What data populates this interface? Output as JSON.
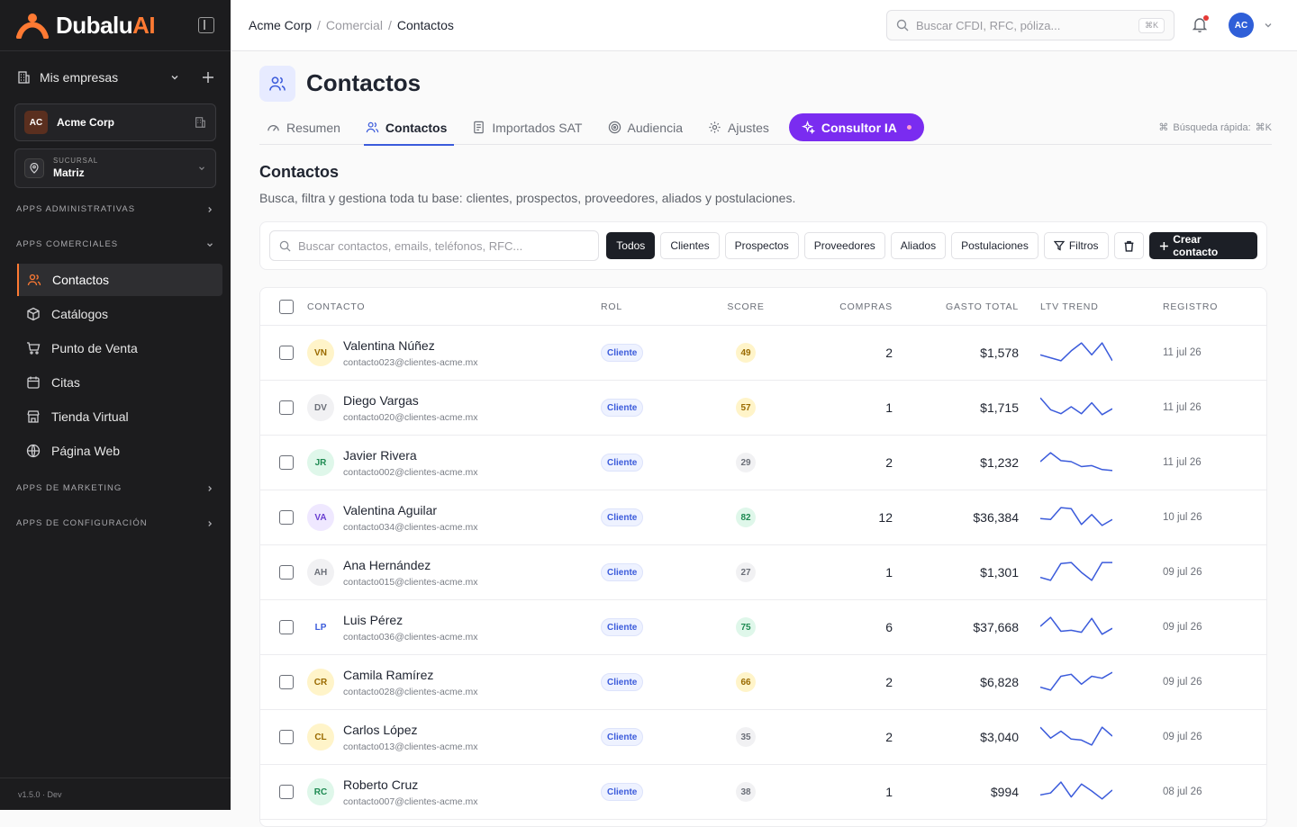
{
  "app": {
    "brand_main": "Dubalu",
    "brand_ai": "AI",
    "version": "v1.5.0 · Dev"
  },
  "sidebar": {
    "mis_empresas": "Mis empresas",
    "company": {
      "initials": "AC",
      "name": "Acme Corp"
    },
    "branch": {
      "label": "SUCURSAL",
      "value": "Matriz"
    },
    "sections": {
      "admin": "APPS ADMINISTRATIVAS",
      "comercial": "APPS COMERCIALES",
      "marketing": "APPS DE MARKETING",
      "config": "APPS DE CONFIGURACIÓN"
    },
    "items": [
      {
        "label": "Contactos",
        "icon": "users-icon"
      },
      {
        "label": "Catálogos",
        "icon": "box-icon"
      },
      {
        "label": "Punto de Venta",
        "icon": "cart-icon"
      },
      {
        "label": "Citas",
        "icon": "calendar-icon"
      },
      {
        "label": "Tienda Virtual",
        "icon": "store-icon"
      },
      {
        "label": "Página Web",
        "icon": "globe-icon"
      }
    ]
  },
  "topbar": {
    "breadcrumb": [
      "Acme Corp",
      "Comercial",
      "Contactos"
    ],
    "search_placeholder": "Buscar CFDI, RFC, póliza...",
    "search_kbd": "⌘K",
    "user_initials": "AC"
  },
  "page": {
    "title": "Contactos",
    "tabs": [
      {
        "label": "Resumen",
        "icon": "gauge-icon"
      },
      {
        "label": "Contactos",
        "icon": "users-icon"
      },
      {
        "label": "Importados SAT",
        "icon": "document-icon"
      },
      {
        "label": "Audiencia",
        "icon": "target-icon"
      },
      {
        "label": "Ajustes",
        "icon": "gear-icon"
      },
      {
        "label": "Consultor IA",
        "icon": "sparkle-icon"
      }
    ],
    "quick_search_label": "Búsqueda rápida:",
    "quick_search_kbd": "⌘K",
    "section_title": "Contactos",
    "section_desc": "Busca, filtra y gestiona toda tu base: clientes, prospectos, proveedores, aliados y postulaciones."
  },
  "filters": {
    "search_placeholder": "Buscar contactos, emails, teléfonos, RFC...",
    "chips": [
      "Todos",
      "Clientes",
      "Prospectos",
      "Proveedores",
      "Aliados",
      "Postulaciones"
    ],
    "filtros": "Filtros",
    "create": "Crear contacto"
  },
  "table": {
    "headers": {
      "contacto": "CONTACTO",
      "rol": "ROL",
      "score": "SCORE",
      "compras": "COMPRAS",
      "gasto": "GASTO TOTAL",
      "ltv": "LTV TREND",
      "registro": "REGISTRO"
    },
    "rows": [
      {
        "initials": "VN",
        "name": "Valentina Núñez",
        "email": "contacto023@clientes-acme.mx",
        "rol": "Cliente",
        "score": "49",
        "compras": "2",
        "gasto": "$1,578",
        "fecha": "11 jul 26",
        "trend": [
          0.35,
          0.2,
          0.05,
          0.55,
          0.95,
          0.35,
          0.95,
          0.05
        ]
      },
      {
        "initials": "DV",
        "name": "Diego Vargas",
        "email": "contacto020@clientes-acme.mx",
        "rol": "Cliente",
        "score": "57",
        "compras": "1",
        "gasto": "$1,715",
        "fecha": "11 jul 26",
        "trend": [
          0.95,
          0.35,
          0.15,
          0.5,
          0.15,
          0.7,
          0.1,
          0.4
        ]
      },
      {
        "initials": "JR",
        "name": "Javier Rivera",
        "email": "contacto002@clientes-acme.mx",
        "rol": "Cliente",
        "score": "29",
        "compras": "2",
        "gasto": "$1,232",
        "fecha": "11 jul 26",
        "trend": [
          0.5,
          0.95,
          0.55,
          0.5,
          0.25,
          0.3,
          0.1,
          0.05
        ]
      },
      {
        "initials": "VA",
        "name": "Valentina Aguilar",
        "email": "contacto034@clientes-acme.mx",
        "rol": "Cliente",
        "score": "82",
        "compras": "12",
        "gasto": "$36,384",
        "fecha": "10 jul 26",
        "trend": [
          0.4,
          0.35,
          0.95,
          0.9,
          0.1,
          0.6,
          0.05,
          0.35
        ]
      },
      {
        "initials": "AH",
        "name": "Ana Hernández",
        "email": "contacto015@clientes-acme.mx",
        "rol": "Cliente",
        "score": "27",
        "compras": "1",
        "gasto": "$1,301",
        "fecha": "09 jul 26",
        "trend": [
          0.2,
          0.05,
          0.9,
          0.95,
          0.45,
          0.05,
          0.95,
          0.95
        ]
      },
      {
        "initials": "LP",
        "name": "Luis Pérez",
        "email": "contacto036@clientes-acme.mx",
        "rol": "Cliente",
        "score": "75",
        "compras": "6",
        "gasto": "$37,668",
        "fecha": "09 jul 26",
        "trend": [
          0.5,
          0.95,
          0.25,
          0.3,
          0.2,
          0.9,
          0.1,
          0.4
        ]
      },
      {
        "initials": "CR",
        "name": "Camila Ramírez",
        "email": "contacto028@clientes-acme.mx",
        "rol": "Cliente",
        "score": "66",
        "compras": "2",
        "gasto": "$6,828",
        "fecha": "09 jul 26",
        "trend": [
          0.2,
          0.05,
          0.75,
          0.85,
          0.35,
          0.75,
          0.65,
          0.95
        ]
      },
      {
        "initials": "CL",
        "name": "Carlos López",
        "email": "contacto013@clientes-acme.mx",
        "rol": "Cliente",
        "score": "35",
        "compras": "2",
        "gasto": "$3,040",
        "fecha": "09 jul 26",
        "trend": [
          0.95,
          0.4,
          0.75,
          0.35,
          0.3,
          0.05,
          0.95,
          0.5
        ]
      },
      {
        "initials": "RC",
        "name": "Roberto Cruz",
        "email": "contacto007@clientes-acme.mx",
        "rol": "Cliente",
        "score": "38",
        "compras": "1",
        "gasto": "$994",
        "fecha": "08 jul 26",
        "trend": [
          0.3,
          0.4,
          0.95,
          0.2,
          0.85,
          0.5,
          0.1,
          0.55
        ]
      }
    ]
  },
  "colors": {
    "accent": "#ff7a33",
    "primary": "#3b5bdb",
    "ia": "#7a2cf0",
    "trend_line": "#3b5bdb",
    "initials": {
      "VN": [
        "#fff4c9",
        "#9a6a00"
      ],
      "DV": [
        "#f1f1f3",
        "#6b6f78"
      ],
      "JR": [
        "#dff7ea",
        "#1e8a52"
      ],
      "VA": [
        "#efe8ff",
        "#6a3fd1"
      ],
      "AH": [
        "#f1f1f3",
        "#6b6f78"
      ],
      "LP": [
        "#ffffff",
        "#3b5bdb"
      ],
      "CR": [
        "#fff4c9",
        "#9a6a00"
      ],
      "CL": [
        "#fff4c9",
        "#9a6a00"
      ],
      "RC": [
        "#dff7ea",
        "#1e8a52"
      ]
    },
    "score": {
      "49": [
        "#fff4c9",
        "#9a6a00"
      ],
      "57": [
        "#fff4c9",
        "#9a6a00"
      ],
      "29": [
        "#f1f1f3",
        "#6b6f78"
      ],
      "82": [
        "#dff7ea",
        "#1e8a52"
      ],
      "27": [
        "#f1f1f3",
        "#6b6f78"
      ],
      "75": [
        "#dff7ea",
        "#1e8a52"
      ],
      "66": [
        "#fff4c9",
        "#9a6a00"
      ],
      "35": [
        "#f1f1f3",
        "#6b6f78"
      ],
      "38": [
        "#f1f1f3",
        "#6b6f78"
      ]
    }
  }
}
